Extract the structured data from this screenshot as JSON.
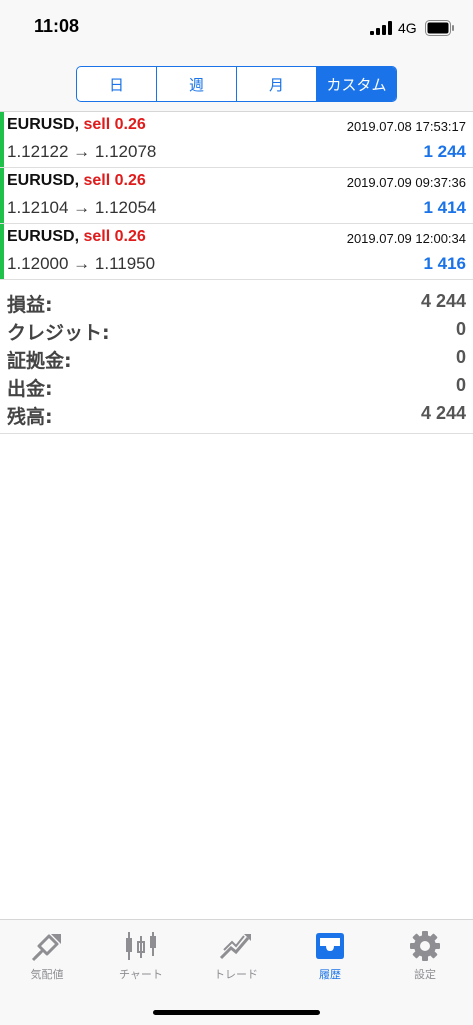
{
  "status_bar": {
    "time": "11:08",
    "network": "4G"
  },
  "period_tabs": [
    {
      "label": "日",
      "active": false
    },
    {
      "label": "週",
      "active": false
    },
    {
      "label": "月",
      "active": false
    },
    {
      "label": "カスタム",
      "active": true
    }
  ],
  "deals": [
    {
      "symbol": "EURUSD,",
      "side": "sell 0.26",
      "time": "2019.07.08 17:53:17",
      "prices": "1.12122 → 1.12078",
      "profit": "1 244"
    },
    {
      "symbol": "EURUSD,",
      "side": "sell 0.26",
      "time": "2019.07.09 09:37:36",
      "prices": "1.12104 → 1.12054",
      "profit": "1 414"
    },
    {
      "symbol": "EURUSD,",
      "side": "sell 0.26",
      "time": "2019.07.09 12:00:34",
      "prices": "1.12000 → 1.11950",
      "profit": "1 416"
    }
  ],
  "summary": [
    {
      "label": "損益:",
      "value": "4 244"
    },
    {
      "label": "クレジット:",
      "value": "0"
    },
    {
      "label": "証拠金:",
      "value": "0"
    },
    {
      "label": "出金:",
      "value": "0"
    },
    {
      "label": "残高:",
      "value": "4 244"
    }
  ],
  "tabbar": [
    {
      "label": "気配値",
      "icon": "quotes-icon",
      "active": false
    },
    {
      "label": "チャート",
      "icon": "chart-icon",
      "active": false
    },
    {
      "label": "トレード",
      "icon": "trade-icon",
      "active": false
    },
    {
      "label": "履歴",
      "icon": "history-icon",
      "active": true
    },
    {
      "label": "設定",
      "icon": "settings-icon",
      "active": false
    }
  ],
  "colors": {
    "accent": "#1a73e8",
    "sell": "#e01b1b",
    "profit": "#1a73e8",
    "deal_marker": "#1fc14a",
    "inactive_tab": "#8e8e93"
  }
}
